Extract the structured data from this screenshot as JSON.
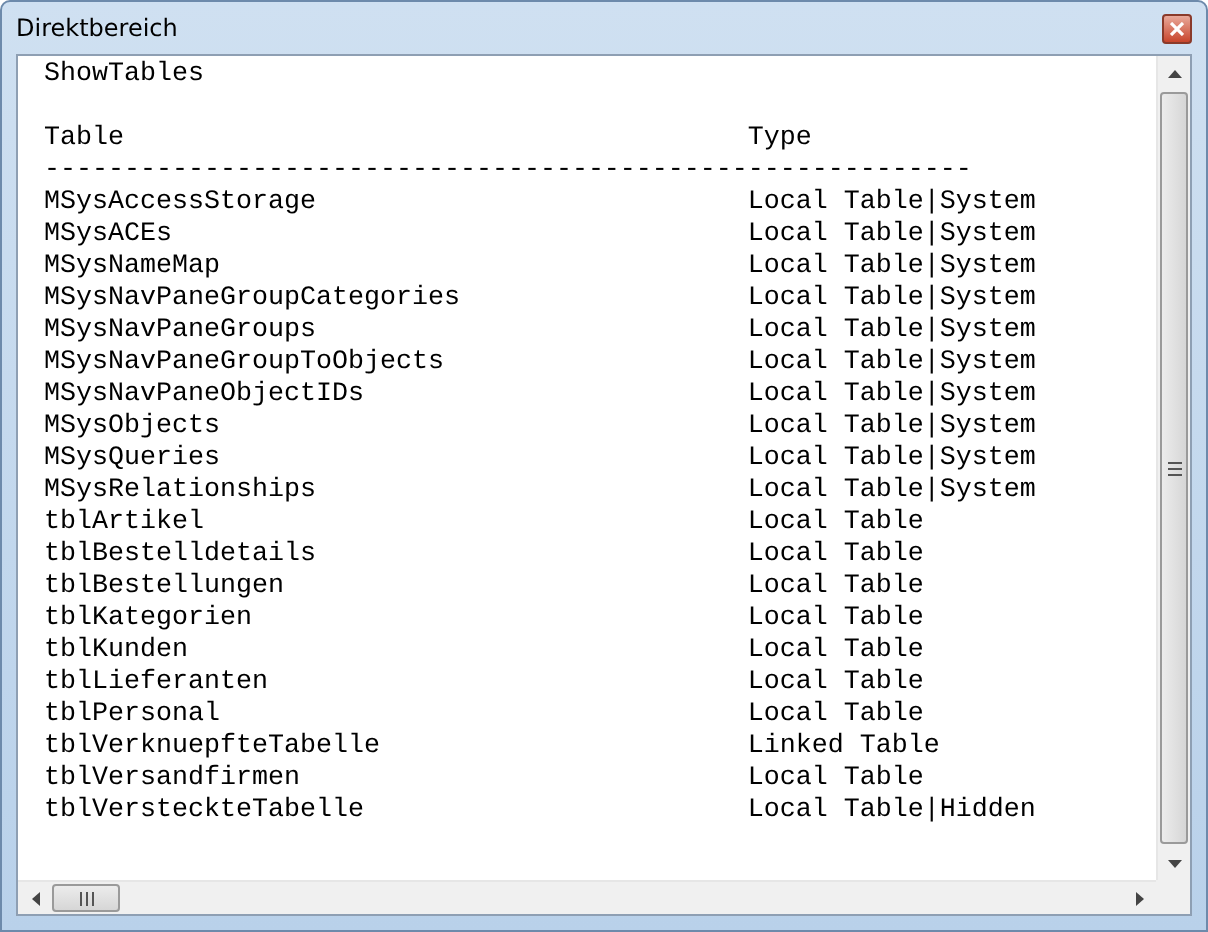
{
  "window": {
    "title": "Direktbereich"
  },
  "output": {
    "command": "ShowTables",
    "columns": [
      "Table",
      "Type"
    ],
    "separator": "----------------------------------------------------------",
    "rows": [
      [
        "MSysAccessStorage",
        "Local Table|System"
      ],
      [
        "MSysACEs",
        "Local Table|System"
      ],
      [
        "MSysNameMap",
        "Local Table|System"
      ],
      [
        "MSysNavPaneGroupCategories",
        "Local Table|System"
      ],
      [
        "MSysNavPaneGroups",
        "Local Table|System"
      ],
      [
        "MSysNavPaneGroupToObjects",
        "Local Table|System"
      ],
      [
        "MSysNavPaneObjectIDs",
        "Local Table|System"
      ],
      [
        "MSysObjects",
        "Local Table|System"
      ],
      [
        "MSysQueries",
        "Local Table|System"
      ],
      [
        "MSysRelationships",
        "Local Table|System"
      ],
      [
        "tblArtikel",
        "Local Table"
      ],
      [
        "tblBestelldetails",
        "Local Table"
      ],
      [
        "tblBestellungen",
        "Local Table"
      ],
      [
        "tblKategorien",
        "Local Table"
      ],
      [
        "tblKunden",
        "Local Table"
      ],
      [
        "tblLieferanten",
        "Local Table"
      ],
      [
        "tblPersonal",
        "Local Table"
      ],
      [
        "tblVerknuepfteTabelle",
        "Linked Table"
      ],
      [
        "tblVersandfirmen",
        "Local Table"
      ],
      [
        "tblVersteckteTabelle",
        "Local Table|Hidden"
      ]
    ]
  }
}
